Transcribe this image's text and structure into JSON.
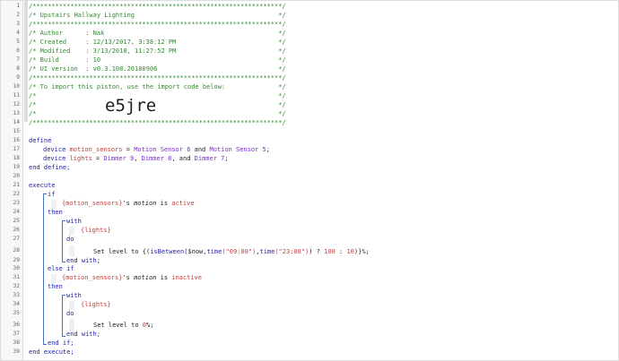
{
  "line_numbers": [
    "1",
    "2",
    "3",
    "4",
    "5",
    "6",
    "7",
    "8",
    "9",
    "10",
    "11",
    "12",
    "13",
    "14",
    "15",
    "16",
    "17",
    "18",
    "19",
    "20",
    "21",
    "22",
    "23",
    "24",
    "25",
    "26",
    "27",
    "28",
    "29",
    "30",
    "31",
    "32",
    "33",
    "34",
    "35",
    "36",
    "37",
    "38",
    "39"
  ],
  "header": {
    "border": "/******************************************************************/",
    "title": "/* Upstairs Hallway Lighting                                      */",
    "author": "/* Author      : Nak                                              */",
    "created": "/* Created     : 12/13/2017, 3:38:12 PM                           */",
    "modified": "/* Modified    : 3/13/2018, 11:27:52 PM                           */",
    "build": "/* Build       : 10                                               */",
    "ui_version": "/* UI version  : v0.3.108.20180906                                */",
    "import_note": "/* To import this piston, use the import code below:              */",
    "blank_comment": "/*                                                                */",
    "import_code": "e5jre"
  },
  "code": {
    "define": "define",
    "device": "device",
    "motion_sensors_var": "motion_sensors",
    "eq": " = ",
    "motion_sensor_6": "Motion Sensor 6",
    "and": " and ",
    "motion_sensor_5": "Motion Sensor 5",
    "semi": ";",
    "lights_var": "lights",
    "dimmer_9": "Dimmer 9",
    "comma": ", ",
    "dimmer_8": "Dimmer 8",
    "comma_and": ", and ",
    "dimmer_7": "Dimmer 7",
    "end_define": "end define;",
    "execute": "execute",
    "if": "if",
    "cond1_dev": "{motion_sensors}",
    "s_prefix": "'s ",
    "attr_motion": "motion",
    "is": " is ",
    "val_active": "active",
    "then": "then",
    "with": "with",
    "lights_dev": "{lights}",
    "do": "do",
    "set_level_to": "Set level to ",
    "expr_open": "{(",
    "fn_isbetween": "isBetween",
    "expr_args1": "($now,",
    "fn_time": "time",
    "str_0900": "(\"09:00\")",
    "expr_comma": ",",
    "str_2300": "(\"23:00\")",
    "expr_mid": ") ? ",
    "num_100": "100",
    "expr_colon": " : ",
    "num_10": "10",
    "expr_close": ")}",
    "pct_semi": "%;",
    "end_with": "end with;",
    "else_if": "else if",
    "val_inactive": "inactive",
    "zero": "0",
    "end_if": "end if;",
    "end_execute": "end execute;"
  },
  "colors": {
    "comment": "#2f8a2f",
    "keyword": "#2222aa",
    "variable": "#c33e3e",
    "device": "#7a2fc9"
  }
}
